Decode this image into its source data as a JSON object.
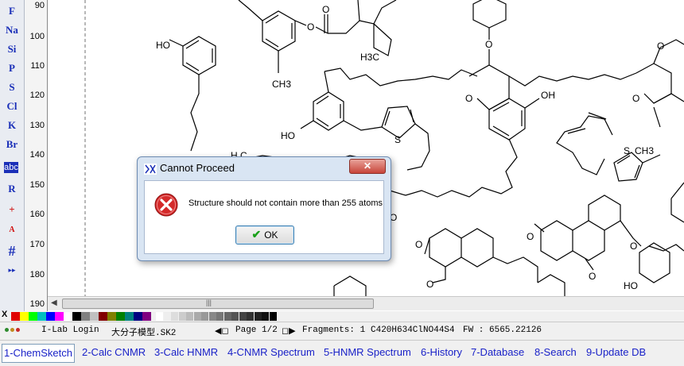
{
  "toolbar": {
    "items": [
      "F",
      "Na",
      "Si",
      "P",
      "S",
      "Cl",
      "K",
      "Br",
      "abc",
      "R",
      "+",
      "A",
      "#"
    ]
  },
  "ruler": {
    "ticks": [
      "90",
      "100",
      "110",
      "120",
      "130",
      "140",
      "150",
      "160",
      "170",
      "180",
      "190"
    ]
  },
  "canvas": {
    "labels": {
      "ho1": "HO",
      "o_ester": "O",
      "o_carbonyl": "O",
      "h3c1": "H3C",
      "ch3_1": "CH3",
      "o_top": "O",
      "o_ring1": "O",
      "oh_1": "OH",
      "o_ring2": "O",
      "o_topright": "O",
      "ho2": "HO",
      "s1": "S",
      "h3c_frag": "H C",
      "s2": "S",
      "ch3_2": "CH3",
      "o_mid": "O",
      "o_lac": "O",
      "o_lac2": "O",
      "o_k1": "O",
      "o_k2": "O",
      "o_eth": "O",
      "ho3": "HO"
    }
  },
  "dialog": {
    "title": "Cannot Proceed",
    "close": "✕",
    "message": "Structure should not contain more than 255 atoms",
    "ok": "OK"
  },
  "palette": {
    "x": "X",
    "colors": [
      "#e00000",
      "#ffff00",
      "#00ff00",
      "#00c0c0",
      "#0000ff",
      "#ff00ff",
      "#ffffff",
      "#000000",
      "#808080",
      "#c0c0c0",
      "#800000",
      "#808000",
      "#008000",
      "#008080",
      "#000080",
      "#800080"
    ]
  },
  "status": {
    "login": "I-Lab Login",
    "file": "大分子模型.SK2",
    "page": "Page 1/2",
    "fragments": "Fragments: 1",
    "formula": "C420H634ClNO44S4",
    "fw": "FW : 6565.22126"
  },
  "tabs": [
    {
      "num": "1",
      "label": "1-ChemSketch"
    },
    {
      "num": "2",
      "label": "2-Calc CNMR"
    },
    {
      "num": "3",
      "label": "3-Calc HNMR"
    },
    {
      "num": "4",
      "label": "4-CNMR Spectrum"
    },
    {
      "num": "5",
      "label": "5-HNMR Spectrum"
    },
    {
      "num": "6",
      "label": "6-History"
    },
    {
      "num": "7",
      "label": "7-Database"
    },
    {
      "num": "8",
      "label": "8-Search"
    },
    {
      "num": "9",
      "label": "9-Update DB"
    }
  ]
}
